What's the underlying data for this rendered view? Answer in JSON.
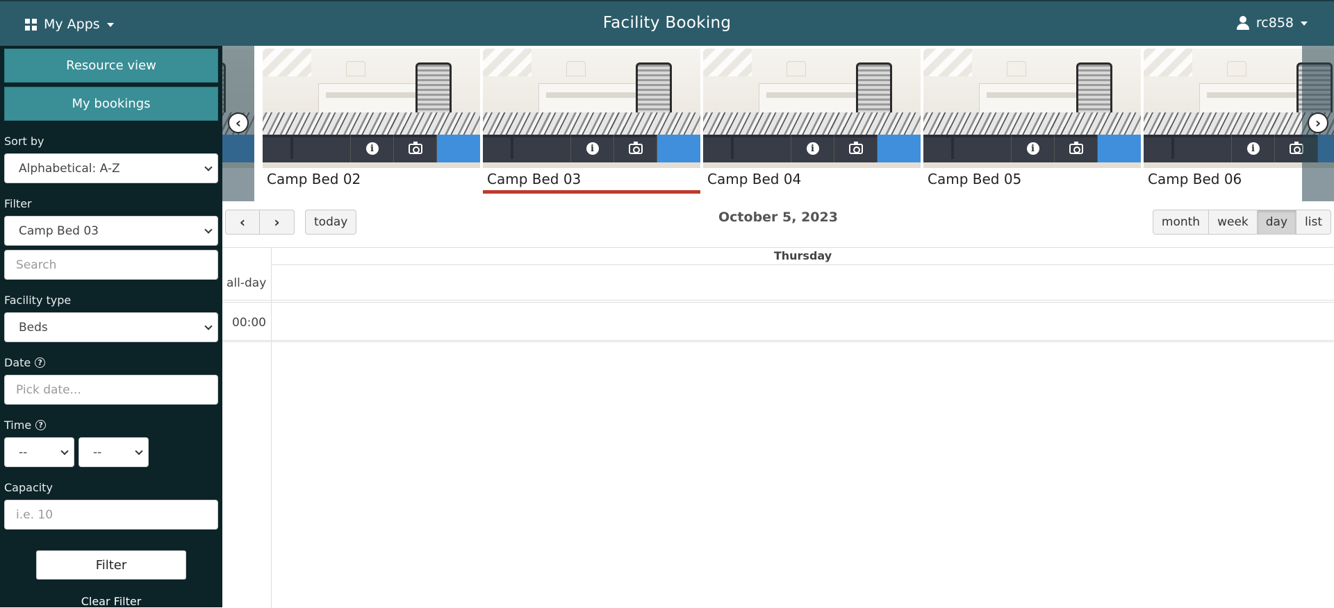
{
  "header": {
    "apps_label": "My Apps",
    "title": "Facility Booking",
    "user": "rc858"
  },
  "sidebar": {
    "resource_view": "Resource view",
    "my_bookings": "My bookings",
    "sort_label": "Sort by",
    "sort_value": "Alphabetical: A-Z",
    "filter_label": "Filter",
    "filter_value": "Camp Bed 03",
    "search_placeholder": "Search",
    "facility_type_label": "Facility type",
    "facility_type_value": "Beds",
    "date_label": "Date",
    "date_placeholder": "Pick date...",
    "time_label": "Time",
    "time_hour": "--",
    "time_minute": "--",
    "capacity_label": "Capacity",
    "capacity_placeholder": "i.e. 10",
    "filter_button": "Filter",
    "clear_filter": "Clear Filter",
    "help_glyph": "?"
  },
  "carousel": {
    "prev_glyph": "‹",
    "next_glyph": "›",
    "info_glyph": "i",
    "items": [
      {
        "name": "Camp Bed 02",
        "selected": false
      },
      {
        "name": "Camp Bed 03",
        "selected": true
      },
      {
        "name": "Camp Bed 04",
        "selected": false
      },
      {
        "name": "Camp Bed 05",
        "selected": false
      },
      {
        "name": "Camp Bed 06",
        "selected": false
      }
    ]
  },
  "calendar": {
    "prev_glyph": "‹",
    "next_glyph": "›",
    "today": "today",
    "title": "October 5, 2023",
    "views": [
      "month",
      "week",
      "day",
      "list"
    ],
    "active_view": "day",
    "day_name": "Thursday",
    "allday_label": "all-day",
    "first_slot": "00:00"
  },
  "colors": {
    "header_bg": "#2c5c6a",
    "sidebar_bg": "#0c2327",
    "sidebar_button": "#3a8e96",
    "book_button": "#3f8fdc",
    "selected_underline": "#c0392b"
  }
}
